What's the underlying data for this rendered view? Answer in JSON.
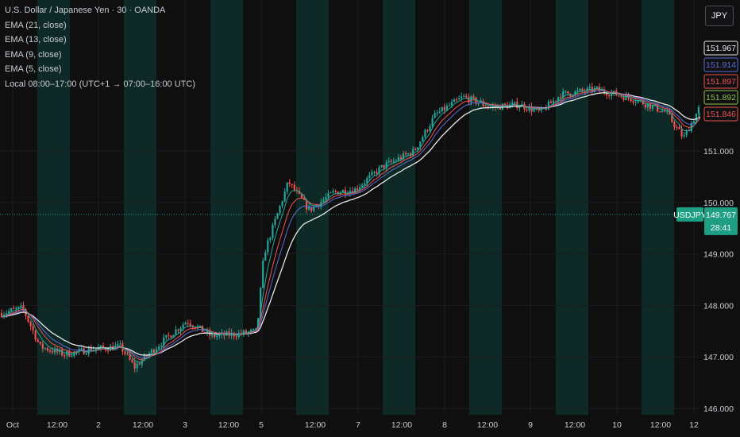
{
  "legend": {
    "title": "U.S. Dollar / Japanese Yen · 30 · OANDA",
    "indicators": [
      "EMA (21, close)",
      "EMA (13, close)",
      "EMA (9, close)",
      "EMA (5, close)"
    ],
    "session": "Local 08:00–17:00 (UTC+1 → 07:00–16:00 UTC)"
  },
  "currency_button": "JPY",
  "colors": {
    "background": "#0f0f10",
    "session_shade": "#0e2a26",
    "up": "#26a69a",
    "down": "#ef5350",
    "ema21": "#e8e8e8",
    "ema13": "#5b6cd6",
    "ema9": "#ef5350",
    "ema5": "#26a69a",
    "current": "#1e9e82"
  },
  "chart_data": {
    "type": "candlestick",
    "y_range": [
      146.0,
      152.6
    ],
    "y_ticks": [
      "146.000",
      "147.000",
      "148.000",
      "149.000",
      "150.000",
      "151.000"
    ],
    "x_ticks": [
      "Oct",
      "12:00",
      "2",
      "12:00",
      "3",
      "12:00",
      "5",
      "12:00",
      "7",
      "12:00",
      "8",
      "12:00",
      "9",
      "12:00",
      "10",
      "12:00",
      "12"
    ],
    "price_labels": [
      {
        "value": "151.967",
        "price": 151.967,
        "kind": "last-high"
      },
      {
        "value": "151.914",
        "price": 151.914,
        "kind": "ema13"
      },
      {
        "value": "151.897",
        "price": 151.897,
        "kind": "ema9"
      },
      {
        "value": "151.892",
        "price": 151.892,
        "kind": "ema5"
      },
      {
        "value": "151.846",
        "price": 151.846,
        "kind": "ema21"
      }
    ],
    "current": {
      "symbol": "USDJPY",
      "price_text": "149.767",
      "price": 149.767,
      "countdown": "28:41"
    },
    "trend_knots": [
      [
        0,
        147.85
      ],
      [
        0.03,
        147.95
      ],
      [
        0.055,
        147.2
      ],
      [
        0.09,
        147.05
      ],
      [
        0.13,
        147.15
      ],
      [
        0.17,
        147.2
      ],
      [
        0.19,
        146.8
      ],
      [
        0.23,
        147.3
      ],
      [
        0.265,
        147.7
      ],
      [
        0.3,
        147.4
      ],
      [
        0.34,
        147.45
      ],
      [
        0.365,
        147.5
      ],
      [
        0.375,
        149.0
      ],
      [
        0.41,
        150.4
      ],
      [
        0.44,
        149.85
      ],
      [
        0.475,
        150.2
      ],
      [
        0.505,
        150.25
      ],
      [
        0.545,
        150.7
      ],
      [
        0.59,
        151.0
      ],
      [
        0.62,
        151.7
      ],
      [
        0.66,
        152.05
      ],
      [
        0.7,
        151.85
      ],
      [
        0.74,
        151.9
      ],
      [
        0.77,
        151.75
      ],
      [
        0.8,
        152.1
      ],
      [
        0.85,
        152.2
      ],
      [
        0.905,
        152.0
      ],
      [
        0.95,
        151.75
      ],
      [
        0.975,
        151.25
      ],
      [
        1.0,
        151.9
      ]
    ]
  }
}
